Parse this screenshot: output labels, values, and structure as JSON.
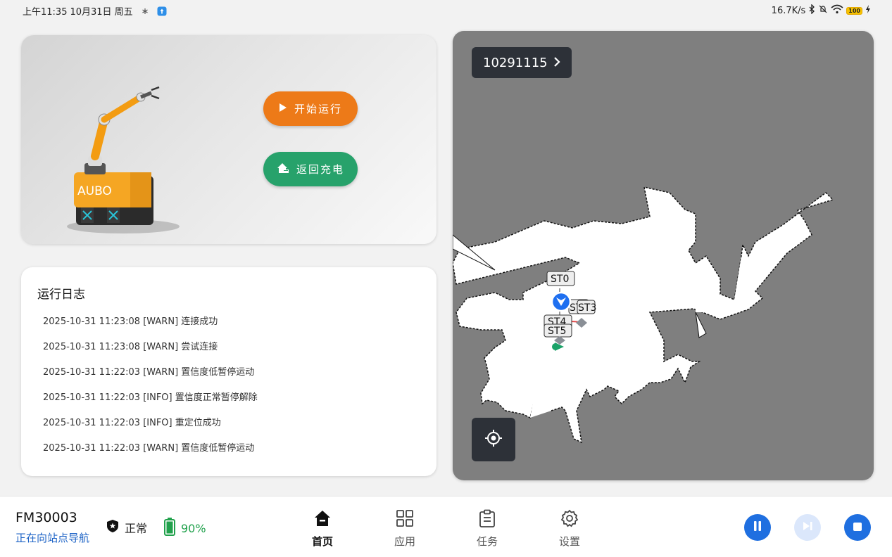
{
  "statusbar": {
    "time": "上午11:35",
    "date": "10月31日 周五",
    "net_speed": "16.7K/s",
    "battery_level": "100"
  },
  "robot_card": {
    "brand": "AUBO",
    "run_button": "开始运行",
    "charge_button": "返回充电",
    "run_color": "#ed7a18",
    "charge_color": "#27a26b"
  },
  "log": {
    "title": "运行日志",
    "entries": [
      "2025-10-31 11:23:08 [WARN] 连接成功",
      "2025-10-31 11:23:08 [WARN] 尝试连接",
      "2025-10-31 11:22:03 [WARN] 置信度低暂停运动",
      "2025-10-31 11:22:03 [INFO] 置信度正常暂停解除",
      "2025-10-31 11:22:03 [INFO] 重定位成功",
      "2025-10-31 11:22:03 [WARN] 置信度低暂停运动"
    ]
  },
  "map": {
    "map_id": "10291115",
    "stations": [
      "ST0",
      "ST2",
      "ST3",
      "ST4",
      "ST5"
    ]
  },
  "bottombar": {
    "robot_name": "FM30003",
    "robot_status": "正在向站点导航",
    "state": "正常",
    "battery": "90%",
    "nav": [
      {
        "label": "首页",
        "icon": "home-icon",
        "active": true
      },
      {
        "label": "应用",
        "icon": "grid-icon",
        "active": false
      },
      {
        "label": "任务",
        "icon": "clipboard-icon",
        "active": false
      },
      {
        "label": "设置",
        "icon": "gear-icon",
        "active": false
      }
    ],
    "accent": "#1d63c6"
  }
}
